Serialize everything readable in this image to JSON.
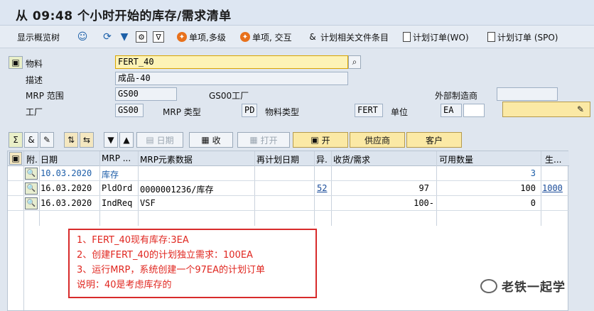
{
  "window": {
    "title": "从 09:48 个小时开始的库存/需求清单"
  },
  "toolbar": {
    "show_overview": "显示概览树",
    "single_multi": "单项,多级",
    "single_interactive": "单项, 交互",
    "plan_files": "计划相关文件条目",
    "planned_order_wo": "计划订单(WO)",
    "planned_order_spo": "计划订单 (SPO)"
  },
  "header": {
    "material_label": "物料",
    "material_value": "FERT_40",
    "desc_label": "描述",
    "desc_value": "成品-40",
    "mrp_area_label": "MRP 范围",
    "mrp_area_value": "GS00",
    "mrp_area_desc": "GS00工厂",
    "ext_procure_label": "外部制造商",
    "plant_label": "工厂",
    "plant_value": "GS00",
    "mrp_type_label": "MRP 类型",
    "mrp_type_value": "PD",
    "mat_type_label": "物料类型",
    "mat_type_value": "FERT",
    "unit_label": "单位",
    "unit_value": "EA"
  },
  "buttons": {
    "date": "日期",
    "receipt": "收",
    "open": "打开",
    "open2": "开",
    "vendor": "供应商",
    "customer": "客户"
  },
  "grid": {
    "headers": [
      "附.",
      "日期",
      "MRP ...",
      "MRP元素数据",
      "再计划日期",
      "异.",
      "收货/需求",
      "可用数量",
      "生..."
    ],
    "rows": [
      {
        "date": "10.03.2020",
        "elem": "库存",
        "data": "",
        "excp": "",
        "qty": "",
        "avail": "3",
        "extra": ""
      },
      {
        "date": "16.03.2020",
        "elem": "PldOrd",
        "data": "0000001236/库存",
        "excp": "52",
        "qty": "97",
        "avail": "100",
        "extra": "1000"
      },
      {
        "date": "16.03.2020",
        "elem": "IndReq",
        "data": "VSF",
        "excp": "",
        "qty": "100-",
        "avail": "0",
        "extra": ""
      }
    ]
  },
  "annotation": {
    "line1": "1、FERT_40现有库存:3EA",
    "line2": "2、创建FERT_40的计划独立需求：100EA",
    "line3": "3、运行MRP，系统创建一个97EA的计划订单",
    "line4": "说明：40是考虑库存的"
  },
  "watermark": {
    "text": "老铁一起学"
  },
  "colors": {
    "annotation_red": "#e0261f",
    "link_blue": "#1a4c9a",
    "active_field": "#fdf3b6"
  }
}
